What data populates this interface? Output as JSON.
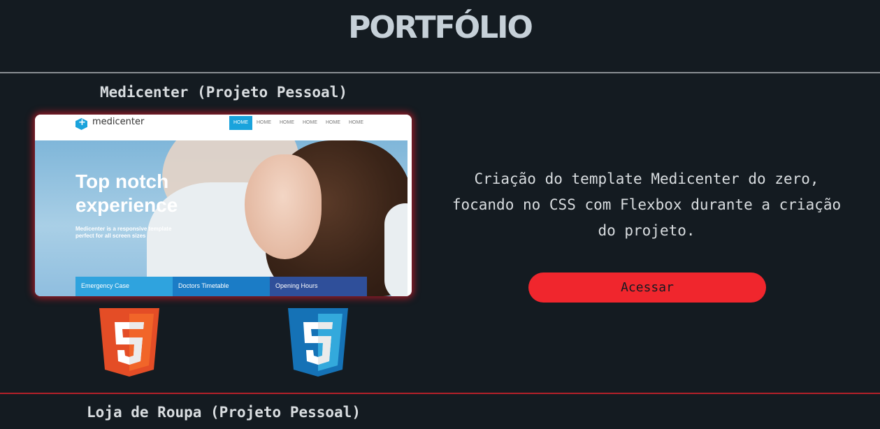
{
  "page": {
    "title": "PORTFÓLIO"
  },
  "projects": [
    {
      "title": "Medicenter (Projeto Pessoal)",
      "description": "Criação do template Medicenter do zero, focando no CSS com Flexbox durante a criação do projeto.",
      "button_label": "Acessar",
      "tech_icons": [
        "html5-icon",
        "css3-icon"
      ],
      "preview": {
        "logo_text": "medicenter",
        "menu": [
          "HOME",
          "HOME",
          "HOME",
          "HOME",
          "HOME",
          "HOME"
        ],
        "hero_title": "Top notch experience",
        "hero_text": "Medicenter is a responsive template perfect for all screen sizes",
        "tabs": [
          "Emergency Case",
          "Doctors Timetable",
          "Opening Hours"
        ]
      }
    },
    {
      "title": "Loja de Roupa (Projeto Pessoal)"
    }
  ],
  "colors": {
    "background": "#141b21",
    "accent": "#f0262d",
    "html5": "#e44d26",
    "css3": "#1572b6"
  }
}
